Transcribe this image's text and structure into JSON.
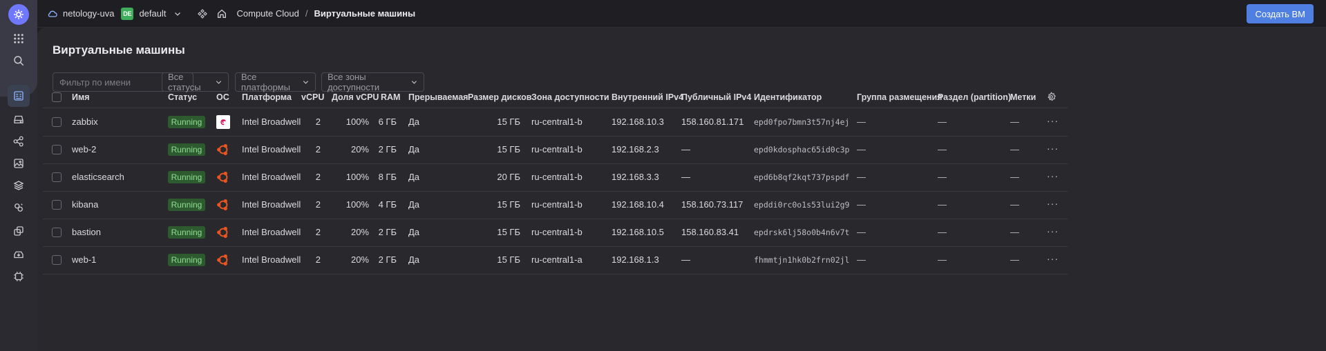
{
  "header": {
    "cloud_name": "netology-uva",
    "folder_badge": "DE",
    "folder_name": "default",
    "breadcrumb_service": "Compute Cloud",
    "breadcrumb_separator": "/",
    "breadcrumb_current": "Виртуальные машины",
    "create_button": "Создать ВМ"
  },
  "page": {
    "title": "Виртуальные машины",
    "filter_placeholder": "Фильтр по имени",
    "filters": [
      "Все статусы",
      "Все платформы",
      "Все зоны доступности"
    ]
  },
  "table": {
    "columns": [
      "Имя",
      "Статус",
      "ОС",
      "Платформа",
      "vCPU",
      "Доля vCPU",
      "RAM",
      "Прерываемая",
      "Размер дисков",
      "Зона доступности",
      "Внутренний IPv4",
      "Публичный IPv4",
      "Идентификатор",
      "Группа размещения",
      "Раздел (partition)",
      "Метки"
    ],
    "rows": [
      {
        "name": "zabbix",
        "status": "Running",
        "os": "debian",
        "platform": "Intel Broadwell",
        "vcpu": "2",
        "core_fraction": "100%",
        "ram": "6 ГБ",
        "preemptible": "Да",
        "disk": "15 ГБ",
        "zone": "ru-central1-b",
        "ipv4": "192.168.10.3",
        "public_ipv4": "158.160.81.171",
        "id": "epd0fpo7bmn3t57nj4ej",
        "group": "—",
        "partition": "—",
        "labels": "—"
      },
      {
        "name": "web-2",
        "status": "Running",
        "os": "ubuntu",
        "platform": "Intel Broadwell",
        "vcpu": "2",
        "core_fraction": "20%",
        "ram": "2 ГБ",
        "preemptible": "Да",
        "disk": "15 ГБ",
        "zone": "ru-central1-b",
        "ipv4": "192.168.2.3",
        "public_ipv4": "—",
        "id": "epd0kdosphac65id0c3p",
        "group": "—",
        "partition": "—",
        "labels": "—"
      },
      {
        "name": "elasticsearch",
        "status": "Running",
        "os": "ubuntu",
        "platform": "Intel Broadwell",
        "vcpu": "2",
        "core_fraction": "100%",
        "ram": "8 ГБ",
        "preemptible": "Да",
        "disk": "20 ГБ",
        "zone": "ru-central1-b",
        "ipv4": "192.168.3.3",
        "public_ipv4": "—",
        "id": "epd6b8qf2kqt737pspdf",
        "group": "—",
        "partition": "—",
        "labels": "—"
      },
      {
        "name": "kibana",
        "status": "Running",
        "os": "ubuntu",
        "platform": "Intel Broadwell",
        "vcpu": "2",
        "core_fraction": "100%",
        "ram": "4 ГБ",
        "preemptible": "Да",
        "disk": "15 ГБ",
        "zone": "ru-central1-b",
        "ipv4": "192.168.10.4",
        "public_ipv4": "158.160.73.117",
        "id": "epddi0rc0o1s53lui2g9",
        "group": "—",
        "partition": "—",
        "labels": "—"
      },
      {
        "name": "bastion",
        "status": "Running",
        "os": "ubuntu",
        "platform": "Intel Broadwell",
        "vcpu": "2",
        "core_fraction": "20%",
        "ram": "2 ГБ",
        "preemptible": "Да",
        "disk": "15 ГБ",
        "zone": "ru-central1-b",
        "ipv4": "192.168.10.5",
        "public_ipv4": "158.160.83.41",
        "id": "epdrsk6lj58o0b4n6v7t",
        "group": "—",
        "partition": "—",
        "labels": "—"
      },
      {
        "name": "web-1",
        "status": "Running",
        "os": "ubuntu",
        "platform": "Intel Broadwell",
        "vcpu": "2",
        "core_fraction": "20%",
        "ram": "2 ГБ",
        "preemptible": "Да",
        "disk": "15 ГБ",
        "zone": "ru-central1-a",
        "ipv4": "192.168.1.3",
        "public_ipv4": "—",
        "id": "fhmmtjn1hk0b2frn02jl",
        "group": "—",
        "partition": "—",
        "labels": "—"
      }
    ]
  },
  "colors": {
    "accent": "#4f7fe0",
    "status_running_bg": "#2e5a2f",
    "status_running_fg": "#8ee08f",
    "ubuntu": "#e95420",
    "debian": "#d70a53"
  }
}
